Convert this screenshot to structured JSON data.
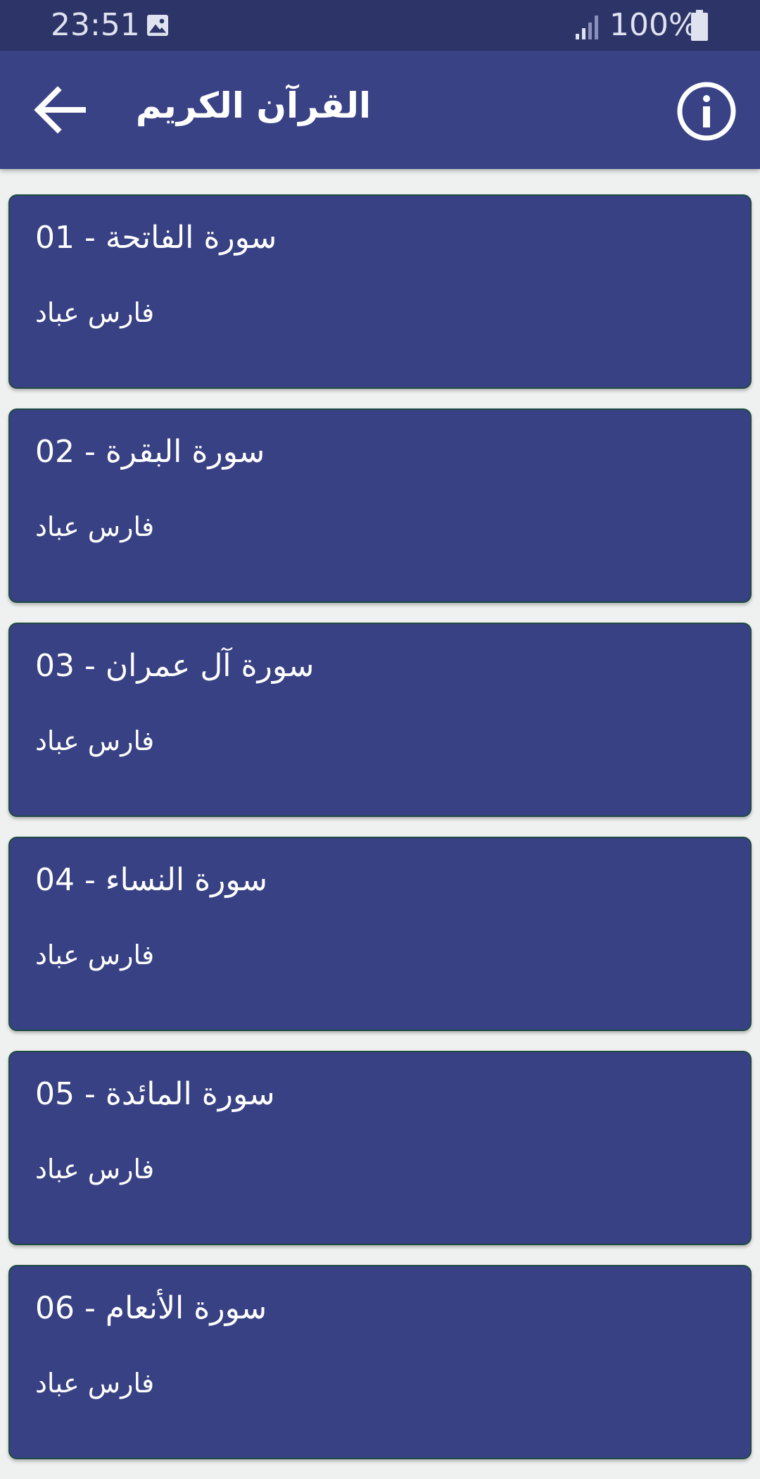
{
  "status_bar": {
    "time": "23:51",
    "battery": "100%",
    "icons": [
      "image-icon",
      "signal-icon",
      "battery-icon"
    ]
  },
  "app_bar": {
    "title": "القرآن الكريم",
    "back_icon": "arrow-back-icon",
    "info_icon": "info-icon"
  },
  "colors": {
    "status_bar": "#2d3468",
    "app_bar": "#394285",
    "card": "#384183",
    "card_border": "#1f4a42",
    "background": "#eef1f0"
  },
  "surahs": [
    {
      "title": "01 - سورة الفاتحة",
      "reciter": "فارس عباد"
    },
    {
      "title": "02 - سورة البقرة",
      "reciter": "فارس عباد"
    },
    {
      "title": "03 - سورة آل عمران",
      "reciter": "فارس عباد"
    },
    {
      "title": "04 - سورة النساء",
      "reciter": "فارس عباد"
    },
    {
      "title": "05 - سورة المائدة",
      "reciter": "فارس عباد"
    },
    {
      "title": "06 - سورة الأنعام",
      "reciter": "فارس عباد"
    }
  ]
}
